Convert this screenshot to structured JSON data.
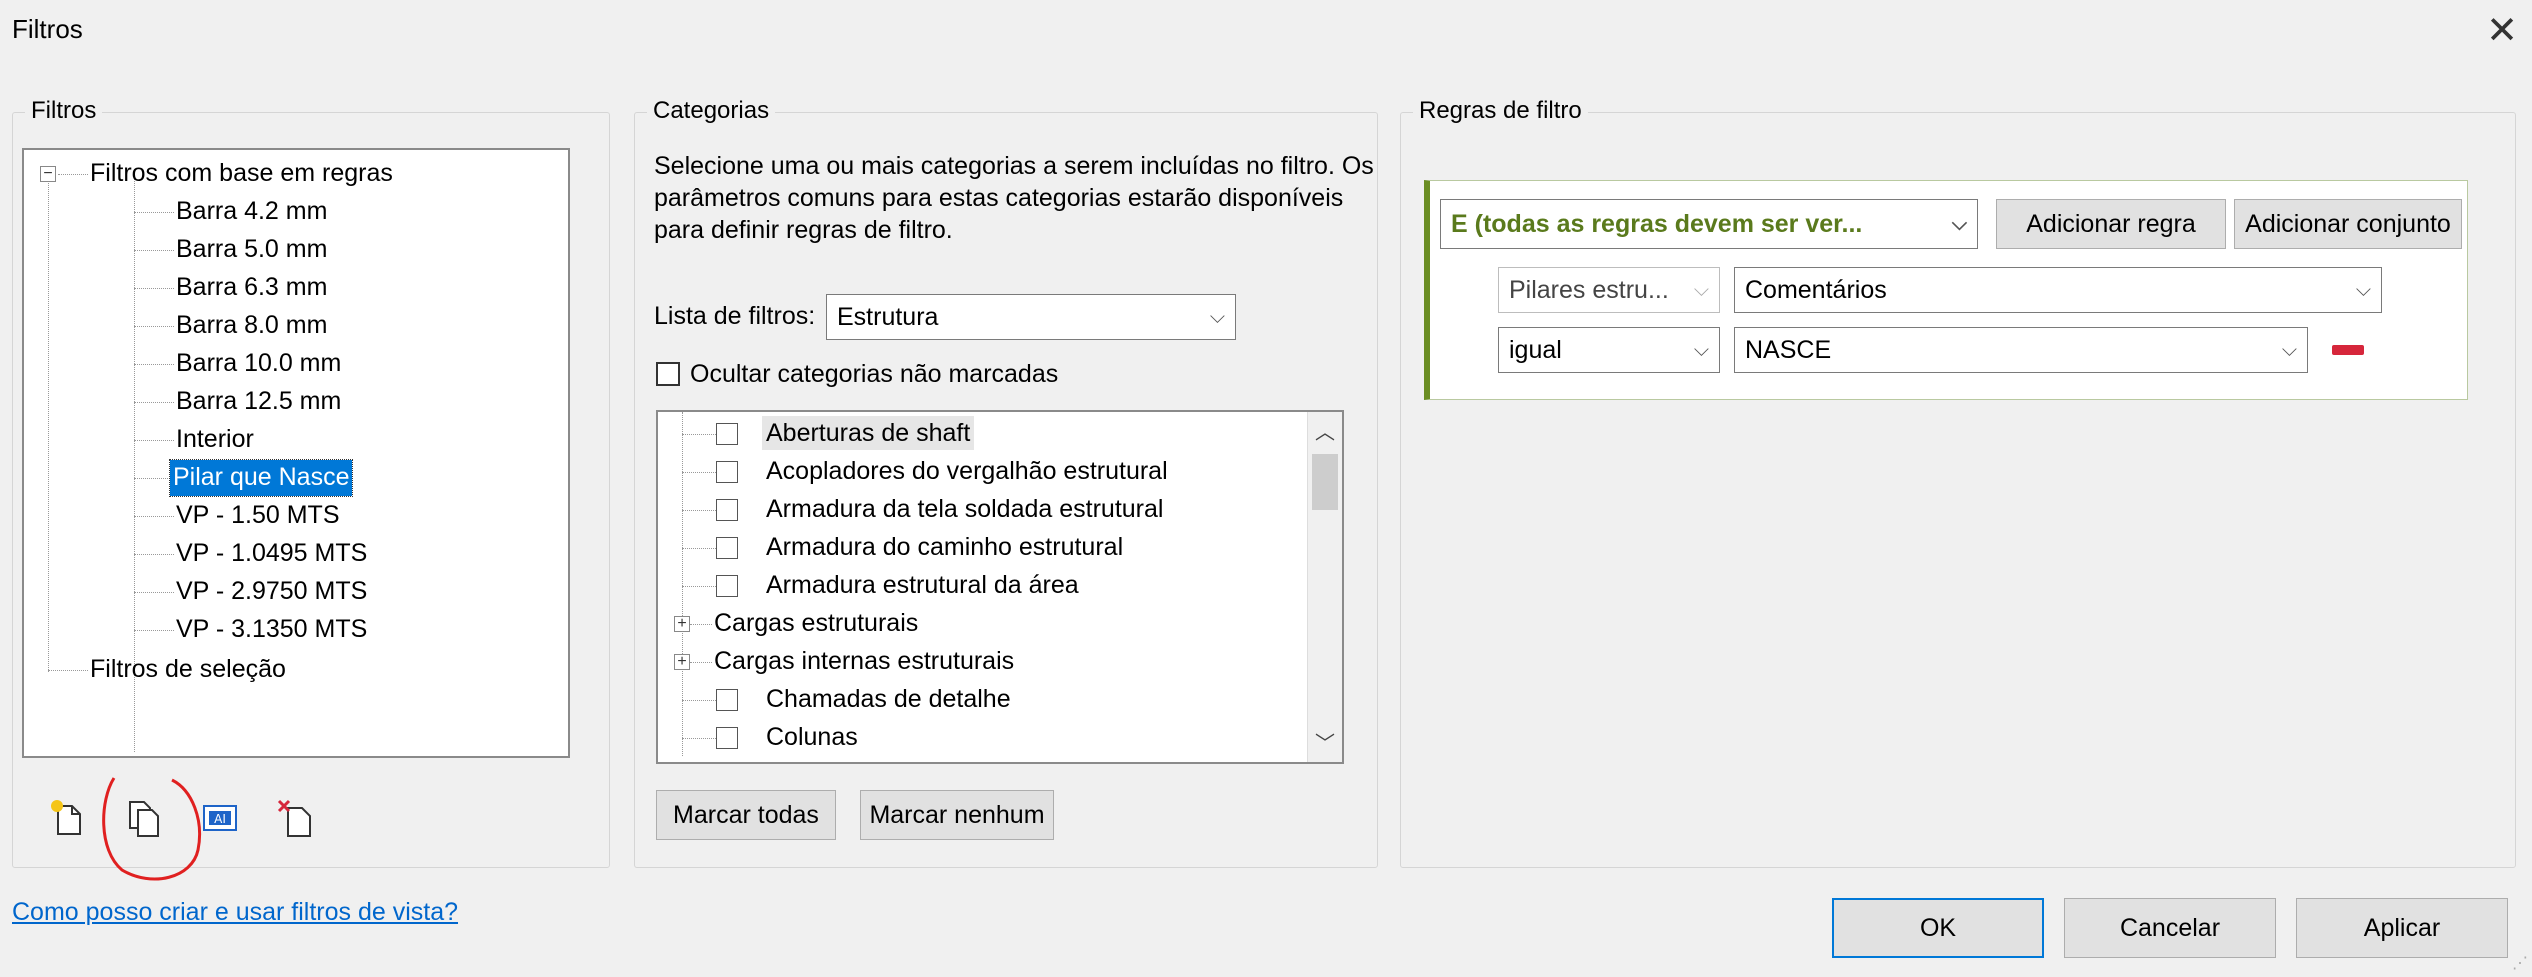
{
  "window": {
    "title": "Filtros"
  },
  "filters_panel": {
    "label": "Filtros",
    "tree": {
      "rule_based": "Filtros com base em regras",
      "items": [
        "Barra 4.2 mm",
        "Barra 5.0 mm",
        "Barra 6.3 mm",
        "Barra 8.0 mm",
        "Barra 10.0 mm",
        "Barra 12.5 mm",
        "Interior",
        "Pilar que Nasce",
        "VP - 1.50 MTS",
        "VP - 1.0495 MTS",
        "VP - 2.9750 MTS",
        "VP - 3.1350 MTS"
      ],
      "selected": "Pilar que Nasce",
      "selection": "Filtros de seleção"
    },
    "tools": [
      "new-filter-icon",
      "duplicate-filter-icon",
      "rename-filter-icon",
      "delete-filter-icon"
    ]
  },
  "categories_panel": {
    "label": "Categorias",
    "description": "Selecione uma ou mais categorias a serem incluídas no filtro. Os parâmetros comuns para estas categorias estarão disponíveis para definir regras de filtro.",
    "filter_list_label": "Lista de filtros:",
    "filter_list_value": "Estrutura",
    "hide_unchecked_label": "Ocultar categorias não marcadas",
    "items": [
      {
        "label": "Aberturas de shaft",
        "type": "check"
      },
      {
        "label": "Acopladores do vergalhão estrutural",
        "type": "check"
      },
      {
        "label": "Armadura da tela soldada estrutural",
        "type": "check"
      },
      {
        "label": "Armadura do caminho estrutural",
        "type": "check"
      },
      {
        "label": "Armadura estrutural da área",
        "type": "check"
      },
      {
        "label": "Cargas estruturais",
        "type": "group"
      },
      {
        "label": "Cargas internas estruturais",
        "type": "group"
      },
      {
        "label": "Chamadas de detalhe",
        "type": "check"
      },
      {
        "label": "Colunas",
        "type": "check"
      }
    ],
    "check_all": "Marcar todas",
    "check_none": "Marcar nenhum"
  },
  "rules_panel": {
    "label": "Regras de filtro",
    "logic": "E (todas as regras devem ser ver...",
    "add_rule": "Adicionar regra",
    "add_set": "Adicionar conjunto",
    "rule": {
      "category": "Pilares estru...",
      "parameter": "Comentários",
      "operator": "igual",
      "value": "NASCE"
    }
  },
  "footer": {
    "help_link": "Como posso criar e usar filtros de vista?",
    "ok": "OK",
    "cancel": "Cancelar",
    "apply": "Aplicar"
  },
  "colors": {
    "accent": "#0078d7",
    "rule_border": "#6b8e23",
    "logic_text": "#5a7a1c",
    "remove": "#d6263b",
    "link": "#0066cc"
  }
}
